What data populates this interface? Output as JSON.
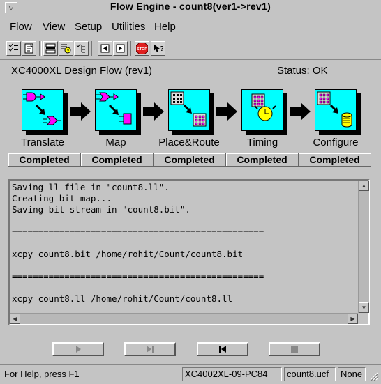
{
  "window": {
    "title": "Flow Engine - count8(ver1->rev1)"
  },
  "menu": [
    {
      "label": "Flow",
      "accel": "F",
      "rest": "low"
    },
    {
      "label": "View",
      "accel": "V",
      "rest": "iew"
    },
    {
      "label": "Setup",
      "accel": "S",
      "rest": "etup"
    },
    {
      "label": "Utilities",
      "accel": "U",
      "rest": "tilities"
    },
    {
      "label": "Help",
      "accel": "H",
      "rest": "elp"
    }
  ],
  "toolbar": {
    "icons": [
      "checklist-icon",
      "options-icon",
      "flow-list-icon",
      "report-clock-icon",
      "check-tree-icon",
      "step-back-icon",
      "step-forward-icon",
      "stop-icon",
      "context-help-icon"
    ],
    "stop_label": "STOP"
  },
  "header": {
    "flow_title": "XC4000XL Design Flow (rev1)",
    "status": "Status: OK"
  },
  "steps": [
    {
      "label": "Translate",
      "state": "Completed",
      "icon": "translate-icon"
    },
    {
      "label": "Map",
      "state": "Completed",
      "icon": "map-icon"
    },
    {
      "label": "Place&Route",
      "state": "Completed",
      "icon": "place-route-icon"
    },
    {
      "label": "Timing",
      "state": "Completed",
      "icon": "timing-icon"
    },
    {
      "label": "Configure",
      "state": "Completed",
      "icon": "configure-icon"
    }
  ],
  "log": {
    "lines": [
      "Saving ll file in \"count8.ll\".",
      "Creating bit map...",
      "Saving bit stream in \"count8.bit\".",
      "",
      "================================================",
      "",
      "xcpy count8.bit /home/rohit/Count/count8.bit",
      "",
      "================================================",
      "",
      "xcpy count8.ll /home/rohit/Count/count8.ll"
    ]
  },
  "statusbar": {
    "help": "For Help, press F1",
    "device": "XC4002XL-09-PC84",
    "ucf": "count8.ucf",
    "extra": "None"
  },
  "colors": {
    "card": "#00ffff",
    "background": "#c4c4c4",
    "accent_magenta": "#ff00ff",
    "clock_yellow": "#ffff00",
    "stop_red": "#e02020"
  }
}
